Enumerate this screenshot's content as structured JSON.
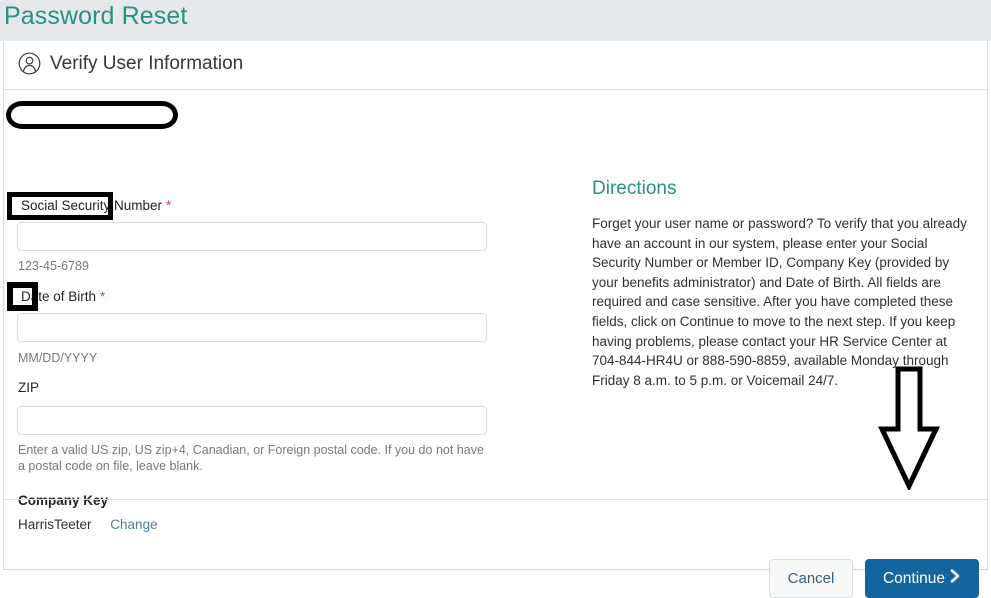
{
  "window": {
    "title": "Password Reset",
    "title_color": "#2a9183",
    "title_bar_bg": "#e5e9eb"
  },
  "card": {
    "header": {
      "icon": "user-avatar-icon",
      "title": "Verify User Information"
    }
  },
  "form": {
    "ssn": {
      "label": "Social Security Number",
      "required_marker": "*",
      "value": "",
      "placeholder": "",
      "helper": "123-45-6789"
    },
    "dob": {
      "label": "Date of Birth",
      "required_marker": "*",
      "value": "",
      "placeholder": "",
      "helper": "MM/DD/YYYY"
    },
    "zip": {
      "label": "ZIP",
      "value": "",
      "placeholder": "",
      "helper": "Enter a valid US zip, US zip+4, Canadian, or Foreign postal code. If you do not have a postal code on file, leave blank."
    },
    "company_key": {
      "label": "Company Key",
      "value": "HarrisTeeter",
      "change_link": "Change"
    }
  },
  "directions": {
    "title": "Directions",
    "title_color": "#2a9183",
    "body": "Forget your user name or password? To verify that you already have an account in our system, please enter your Social Security Number or Member ID, Company Key (provided by your benefits administrator) and Date of Birth. All fields are required and case sensitive. After you have completed these fields, click on Continue to move to the next step. If you keep having problems, please contact your HR Service Center at 704-844-HR4U or 888-590-8859, available Monday through Friday 8 a.m. to 5 p.m. or Voicemail 24/7."
  },
  "footer": {
    "cancel_label": "Cancel",
    "continue_label": "Continue",
    "continue_icon": "chevron-right-icon",
    "continue_color": "#1464a0"
  },
  "annotations": {
    "ssn_highlight": "ellipse-outline-around-social-security-number-label",
    "dob_highlight": "rectangle-outline-around-date-of-birth-label",
    "zip_highlight": "rectangle-outline-around-zip-label",
    "continue_arrow": "down-arrow-outline-pointing-to-continue-button",
    "color": "#000000"
  }
}
